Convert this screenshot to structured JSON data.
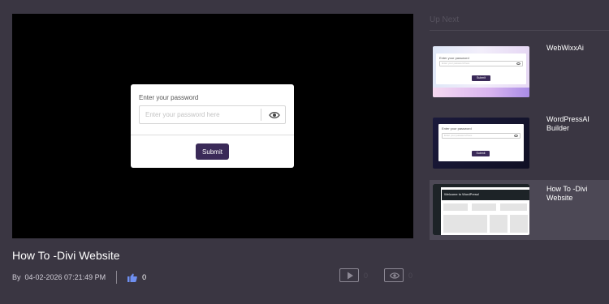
{
  "player": {
    "password_label": "Enter your password",
    "password_placeholder": "Enter your password here",
    "submit_label": "Submit"
  },
  "video": {
    "title": "How To -Divi Website",
    "by_label": "By",
    "date": "04-02-2026 07:21:49 PM",
    "likes": "0",
    "plays": "0",
    "views": "0"
  },
  "up_next": {
    "title": "Up Next",
    "items": [
      {
        "title": "WebWixxAi",
        "thumb_label": "Enter your password",
        "thumb_placeholder": "Enter your password here",
        "thumb_submit": "Submit"
      },
      {
        "title": "WordPressAI Builder",
        "thumb_label": "Enter your password",
        "thumb_placeholder": "Enter your password here",
        "thumb_submit": "Submit"
      },
      {
        "title": "How To -Divi Website",
        "thumb_banner": "Welcome to WordPress!"
      }
    ]
  },
  "colors": {
    "background": "#3a3642",
    "submit_button": "#3a2a58",
    "like_icon": "#6e8ff0",
    "active_item": "#4c4855"
  }
}
